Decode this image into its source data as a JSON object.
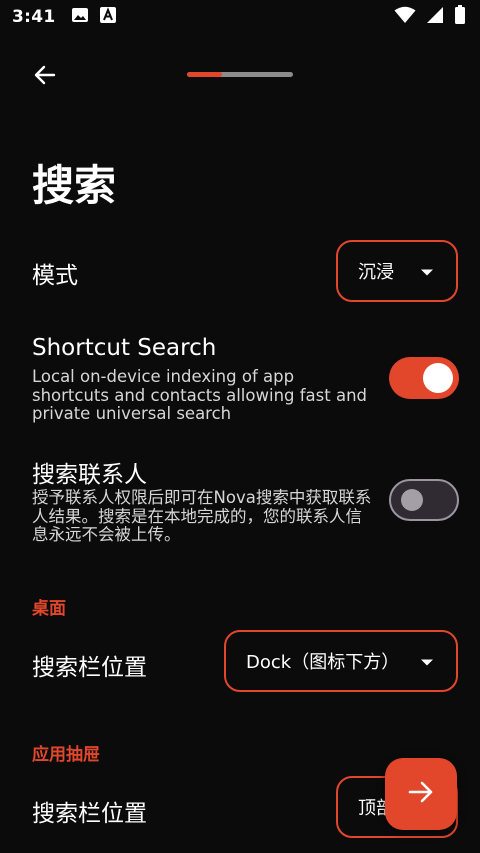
{
  "status_bar": {
    "time": "3:41"
  },
  "header": {
    "progress_fraction": 0.33,
    "title": "搜索"
  },
  "mode": {
    "label": "模式",
    "value": "沉浸"
  },
  "shortcut_search": {
    "title": "Shortcut Search",
    "description": "Local on-device indexing of app shortcuts and contacts allowing fast and private universal search",
    "enabled": true
  },
  "search_contacts": {
    "title": "搜索联系人",
    "description": "授予联系人权限后即可在Nova搜索中获取联系人结果。搜索是在本地完成的，您的联系人信息永远不会被上传。",
    "enabled": false
  },
  "desktop_section": {
    "header": "桌面",
    "search_bar_position_label": "搜索栏位置",
    "search_bar_position_value": "Dock（图标下方）"
  },
  "drawer_section": {
    "header": "应用抽屉",
    "search_bar_position_label": "搜索栏位置",
    "search_bar_position_value": "顶部"
  },
  "colors": {
    "accent": "#e2472b",
    "background": "#0b0b0c"
  },
  "icons": {
    "back": "arrow-left",
    "fab": "arrow-right",
    "dropdown": "caret-down"
  }
}
